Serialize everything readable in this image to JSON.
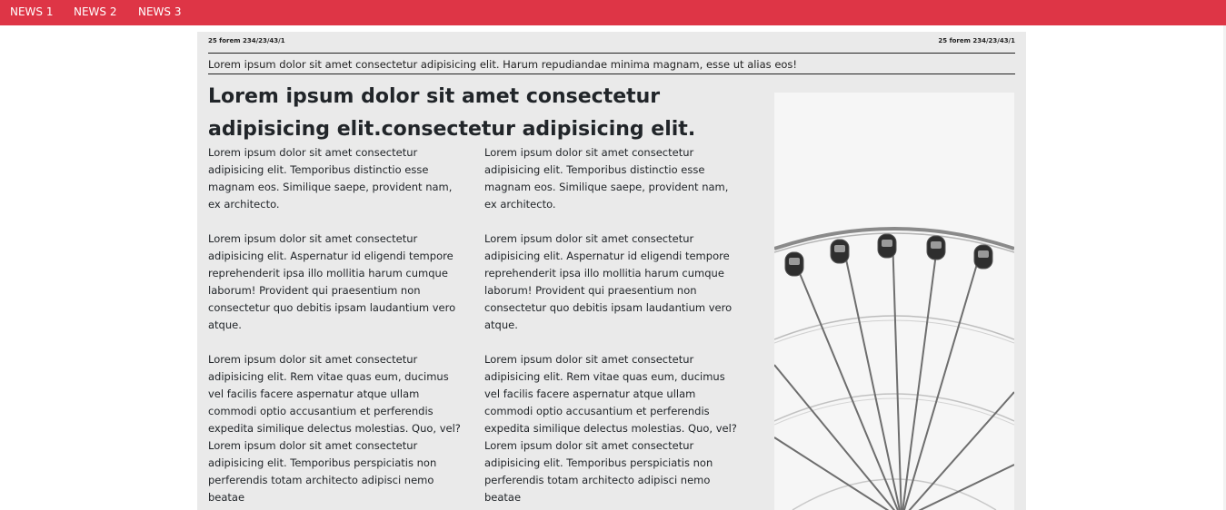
{
  "nav": {
    "items": [
      {
        "label": "NEWS 1"
      },
      {
        "label": "NEWS 2"
      },
      {
        "label": "NEWS 3"
      }
    ]
  },
  "article": {
    "meta_left": "25 forem 234/23/43/1",
    "meta_right": "25 forem 234/23/43/1",
    "subtitle": "Lorem ipsum dolor sit amet consectetur adipisicing elit. Harum repudiandae minima magnam, esse ut alias eos!",
    "headline": "Lorem ipsum dolor sit amet consectetur adipisicing elit.consectetur adipisicing elit.",
    "columns": [
      {
        "paragraphs": [
          "Lorem ipsum dolor sit amet consectetur adipisicing elit. Temporibus distinctio esse magnam eos. Similique saepe, provident nam, ex architecto.",
          "Lorem ipsum dolor sit amet consectetur adipisicing elit. Aspernatur id eligendi tempore reprehenderit ipsa illo mollitia harum cumque laborum! Provident qui praesentium non consectetur quo debitis ipsam laudantium vero atque.",
          "Lorem ipsum dolor sit amet consectetur adipisicing elit. Rem vitae quas eum, ducimus vel facilis facere aspernatur atque ullam commodi optio accusantium et perferendis expedita similique delectus molestias. Quo, vel? Lorem ipsum dolor sit amet consectetur adipisicing elit. Temporibus perspiciatis non perferendis totam architecto adipisci nemo beatae"
        ]
      },
      {
        "paragraphs": [
          "Lorem ipsum dolor sit amet consectetur adipisicing elit. Temporibus distinctio esse magnam eos. Similique saepe, provident nam, ex architecto.",
          "Lorem ipsum dolor sit amet consectetur adipisicing elit. Aspernatur id eligendi tempore reprehenderit ipsa illo mollitia harum cumque laborum! Provident qui praesentium non consectetur quo debitis ipsam laudantium vero atque.",
          "Lorem ipsum dolor sit amet consectetur adipisicing elit. Rem vitae quas eum, ducimus vel facilis facere aspernatur atque ullam commodi optio accusantium et perferendis expedita similique delectus molestias. Quo, vel? Lorem ipsum dolor sit amet consectetur adipisicing elit. Temporibus perspiciatis non perferendis totam architecto adipisci nemo beatae"
        ]
      }
    ],
    "image": {
      "subject": "ferris-wheel-photo"
    }
  },
  "colors": {
    "navbar": "#de3546",
    "paper": "#eaeaea",
    "text": "#212529"
  }
}
